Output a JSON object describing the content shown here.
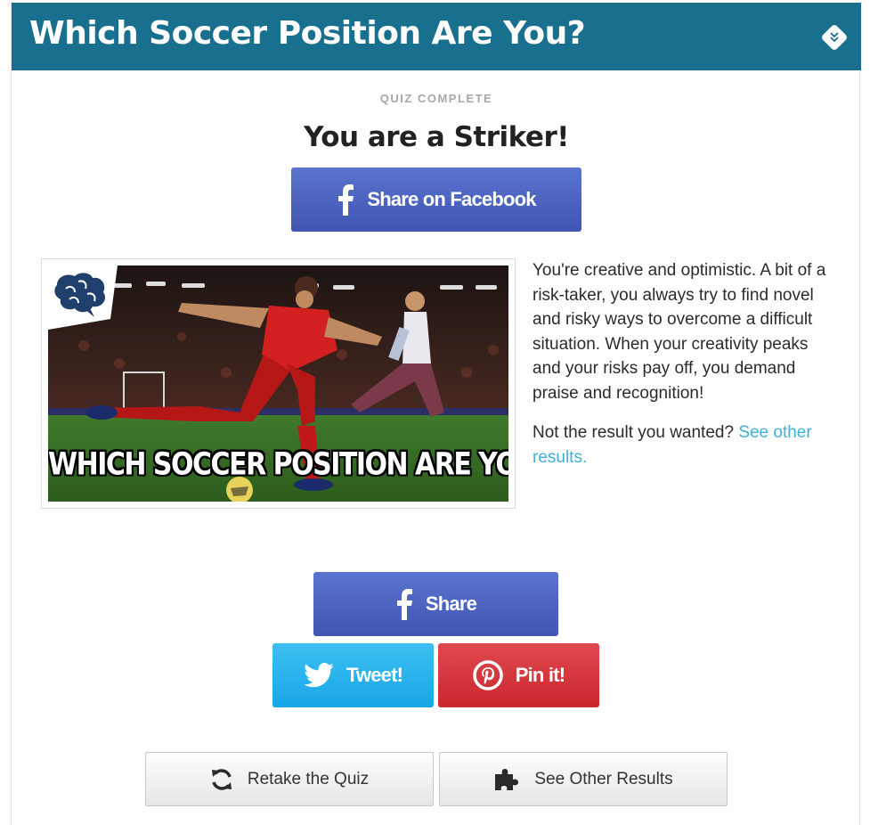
{
  "header": {
    "title": "Which Soccer Position Are You?",
    "collapse_icon": "chevron-double-down-icon"
  },
  "result": {
    "label": "QUIZ COMPLETE",
    "title": "You are a Striker!",
    "share_top_label": "Share on Facebook",
    "image_caption": "WHICH SOCCER POSITION ARE YOU?",
    "description": "You're creative and optimistic. A bit of a risk-taker, you always try to find novel and risky ways to overcome a difficult situation. When your creativity peaks and your risks pay off, you demand praise and recognition!",
    "not_wanted_text": "Not the result you wanted?",
    "see_other_link": "See other results."
  },
  "share": {
    "facebook_label": "Share",
    "twitter_label": "Tweet!",
    "pinterest_label": "Pin it!"
  },
  "actions": {
    "retake_label": "Retake the Quiz",
    "see_other_label": "See Other Results"
  },
  "colors": {
    "header_bg": "#186f8e",
    "facebook": "#4a62c0",
    "twitter": "#29b3ec",
    "pinterest": "#d6363c",
    "link": "#40b0d8"
  }
}
